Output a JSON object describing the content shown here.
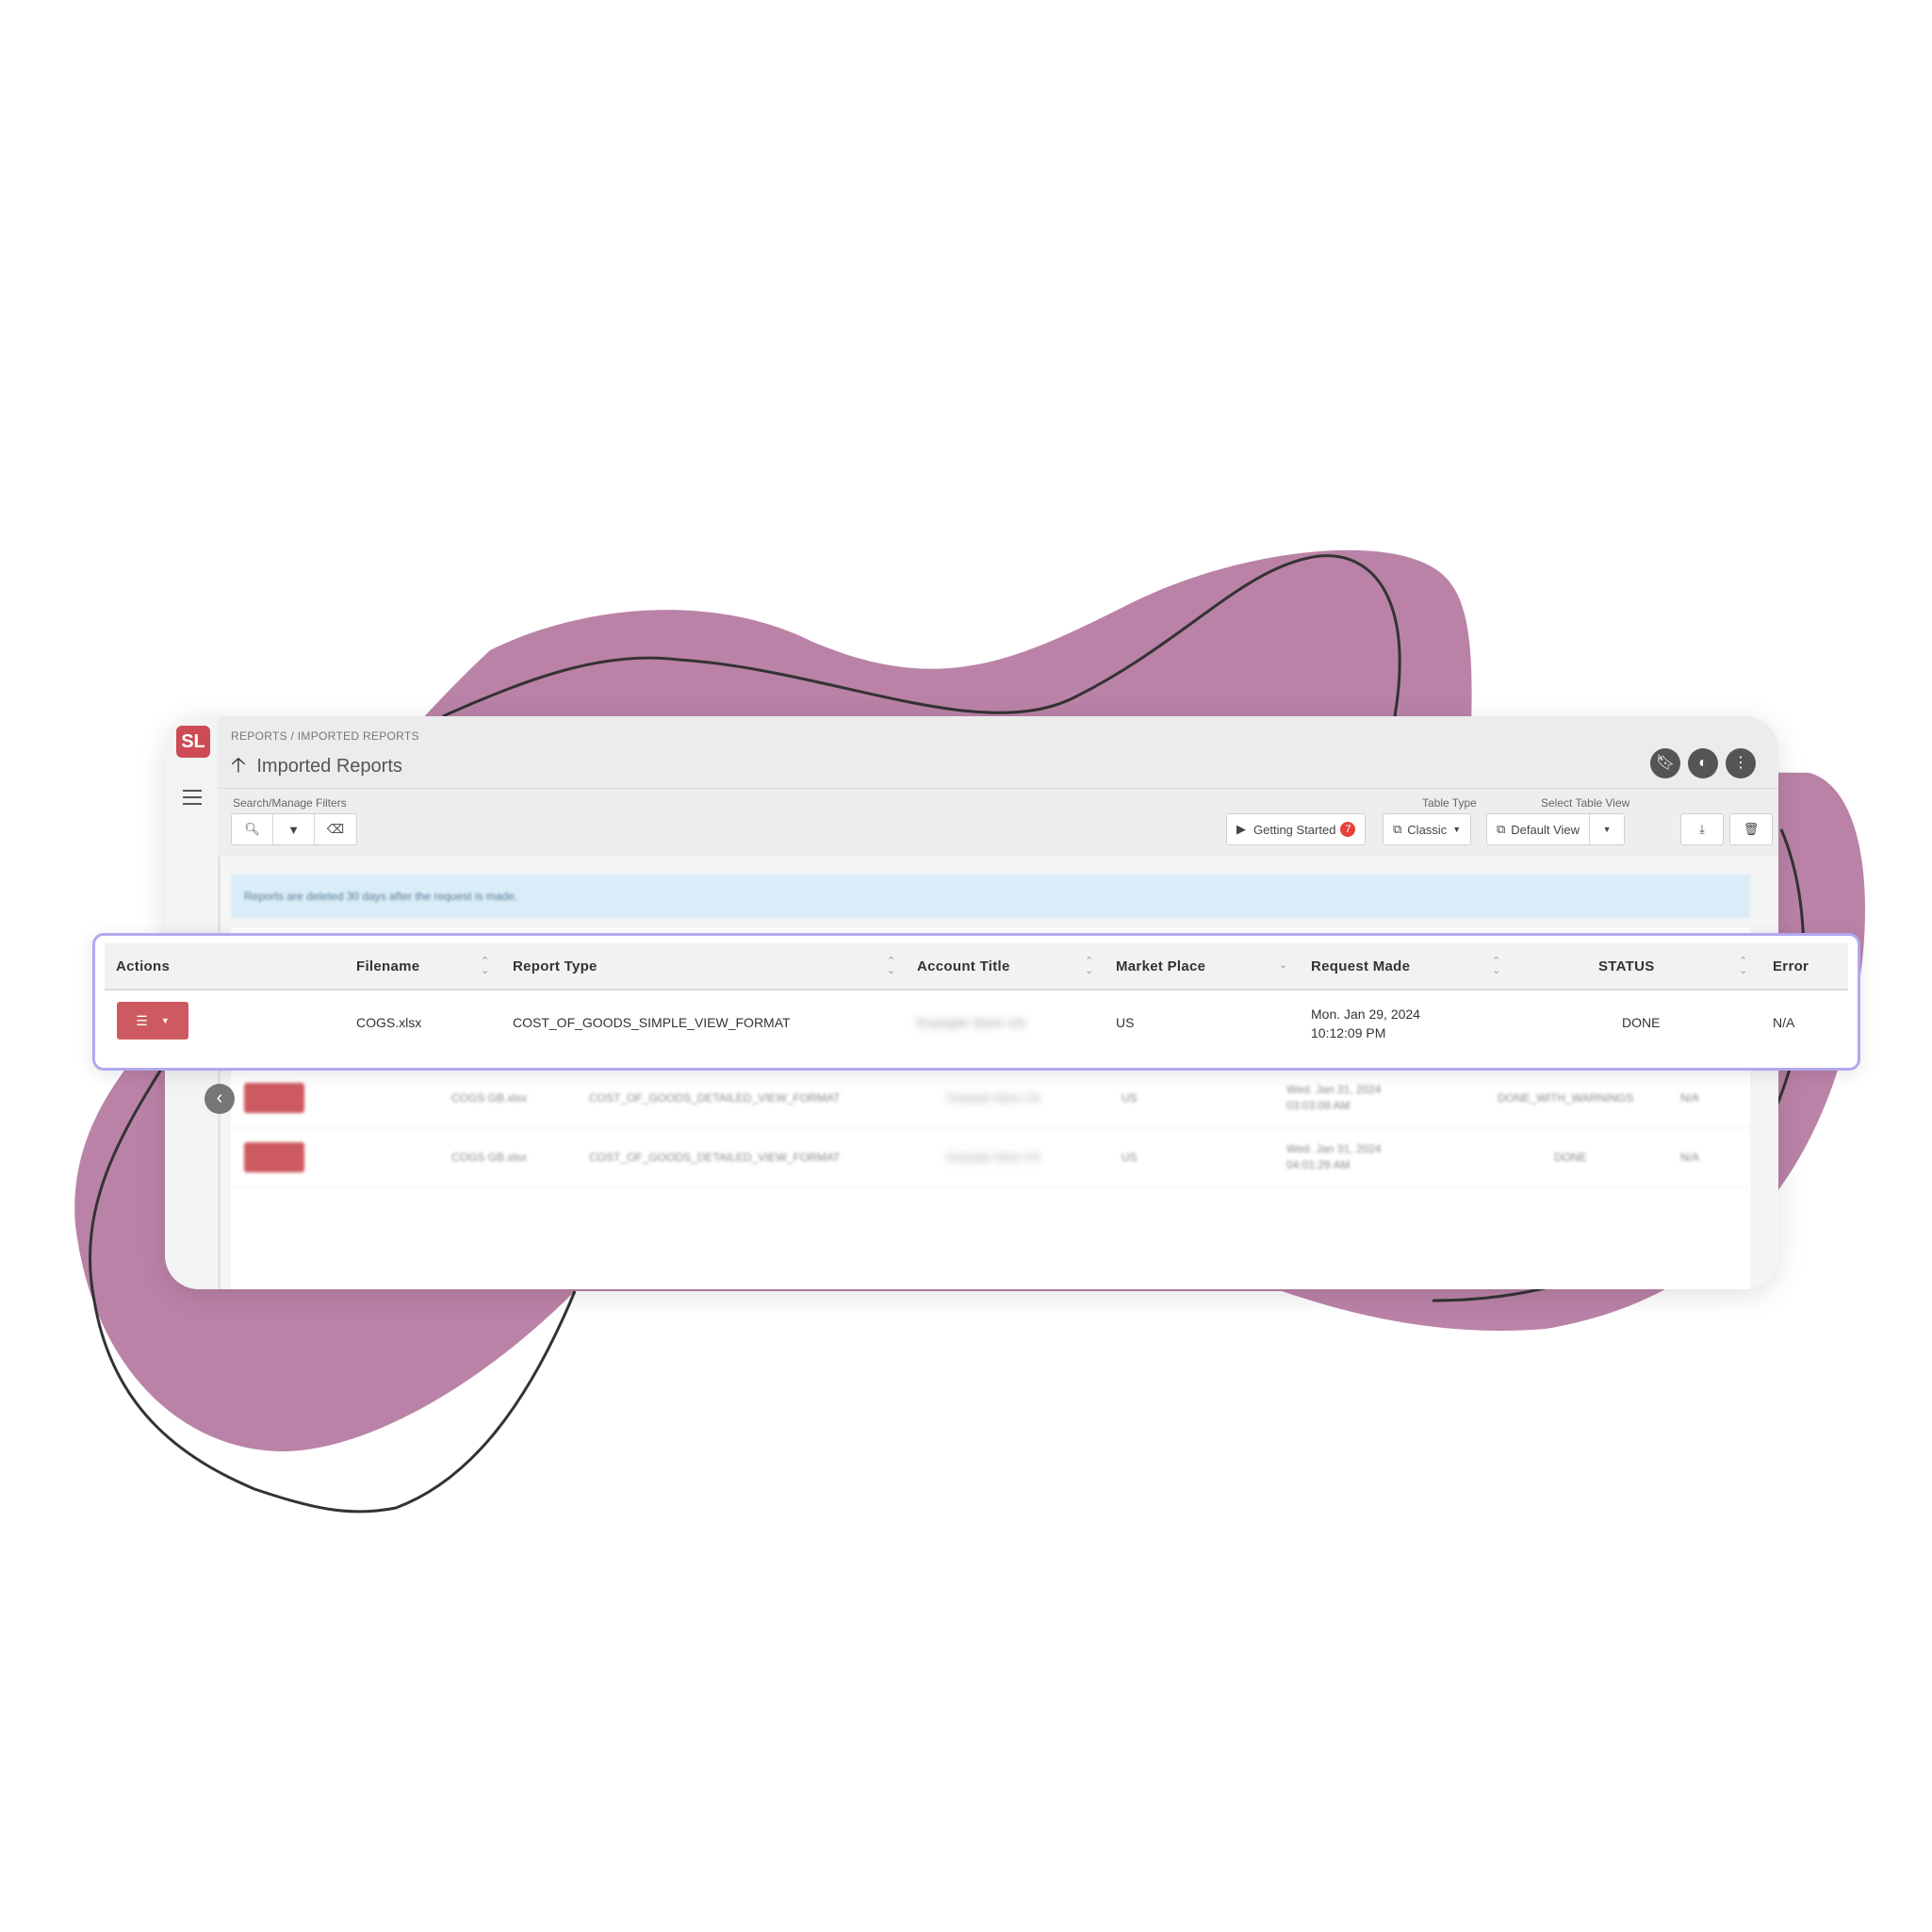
{
  "app": {
    "logo_text": "SL",
    "breadcrumb": "REPORTS / IMPORTED REPORTS",
    "title": "Imported Reports",
    "title_icon": "arrow-up-icon"
  },
  "header_icons": [
    "bookmark-icon",
    "contrast-icon",
    "more-vertical-icon"
  ],
  "toolbar": {
    "filters_label": "Search/Manage Filters",
    "filter_icons": [
      "search-icon",
      "filter-icon",
      "clear-filter-icon"
    ],
    "getting_started_label": "Getting Started",
    "getting_started_badge": "7",
    "table_type_label": "Table Type",
    "table_type_value": "Classic",
    "table_view_label": "Select Table View",
    "table_view_value": "Default View",
    "download_icon": "download-icon",
    "delete_icon": "trash-icon"
  },
  "notice": "Reports are deleted 30 days after the request is made.",
  "table": {
    "columns": [
      "Actions",
      "Filename",
      "Report Type",
      "Account Title",
      "Market Place",
      "Request Made",
      "STATUS",
      "Error"
    ],
    "focused_row": {
      "filename": "COGS.xlsx",
      "report_type": "COST_OF_GOODS_SIMPLE_VIEW_FORMAT",
      "account_title": "Example Store US",
      "market_place": "US",
      "request_date": "Mon. Jan 29, 2024",
      "request_time": "10:12:09 PM",
      "status": "DONE",
      "error": "N/A"
    },
    "background_rows": [
      {
        "filename": "COGS GB.xlsx",
        "report_type": "COST_OF_GOODS_DETAILED_VIEW_FORMAT",
        "account_title": "Example Store US",
        "market_place": "US",
        "request_date": "Wed. Jan 31, 2024",
        "request_time": "03:03:09 AM",
        "status": "DONE_WITH_WARNINGS",
        "error": "N/A"
      },
      {
        "filename": "COGS GB.xlsx",
        "report_type": "COST_OF_GOODS_DETAILED_VIEW_FORMAT",
        "account_title": "Example Store US",
        "market_place": "US",
        "request_date": "Wed. Jan 31, 2024",
        "request_time": "04:01:29 AM",
        "status": "DONE",
        "error": "N/A"
      }
    ]
  },
  "colors": {
    "blob": "#bb82a7",
    "action_button": "#cd5a60",
    "focus_border": "#b2a8f0",
    "notice_bg": "#d9ecf8"
  }
}
